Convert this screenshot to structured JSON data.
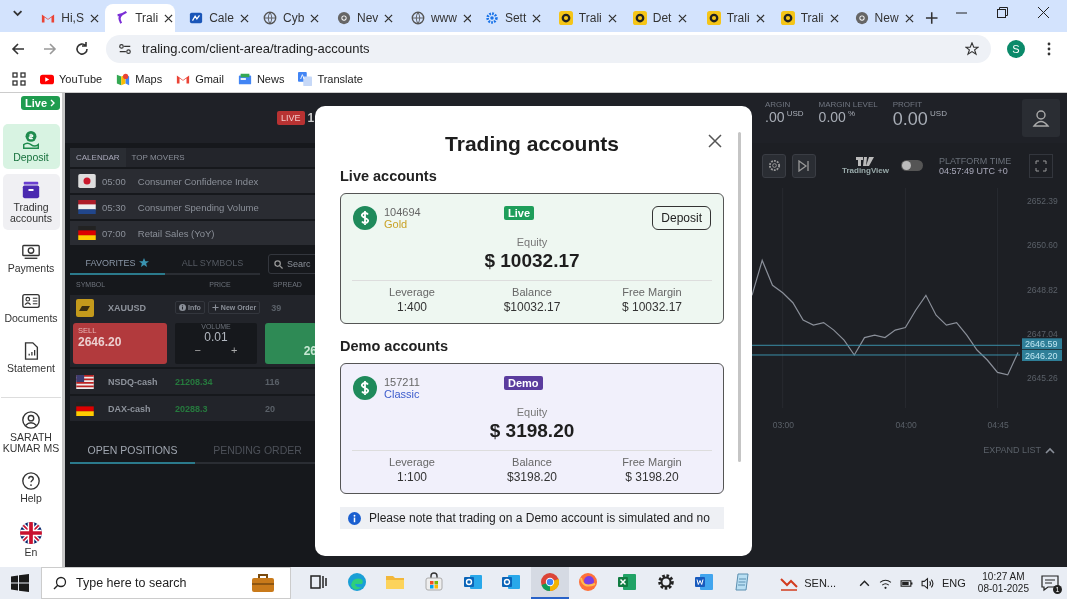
{
  "browser": {
    "tabs": [
      {
        "title": "Hi,S",
        "kind": "gmail",
        "selected": false
      },
      {
        "title": "Trali",
        "kind": "traling",
        "selected": true
      },
      {
        "title": "Cale",
        "kind": "calendar",
        "selected": false
      },
      {
        "title": "Cyb",
        "kind": "globe",
        "selected": false
      },
      {
        "title": "Nev",
        "kind": "chrome",
        "selected": false
      },
      {
        "title": "www",
        "kind": "globe",
        "selected": false
      },
      {
        "title": "Sett",
        "kind": "gear",
        "selected": false
      },
      {
        "title": "Trali",
        "kind": "coin",
        "selected": false
      },
      {
        "title": "Det",
        "kind": "coin",
        "selected": false
      },
      {
        "title": "Trali",
        "kind": "coin",
        "selected": false
      },
      {
        "title": "Trali",
        "kind": "coin",
        "selected": false
      },
      {
        "title": "New",
        "kind": "chrome",
        "selected": false
      }
    ],
    "url": "traling.com/client-area/trading-accounts",
    "profile_initial": "S",
    "bookmarks": [
      {
        "label": "YouTube",
        "kind": "youtube"
      },
      {
        "label": "Maps",
        "kind": "maps"
      },
      {
        "label": "Gmail",
        "kind": "gmail"
      },
      {
        "label": "News",
        "kind": "news"
      },
      {
        "label": "Translate",
        "kind": "translate"
      }
    ]
  },
  "sidebar": {
    "live_badge": "Live",
    "items": [
      {
        "label": "Deposit",
        "kind": "deposit",
        "selected": true,
        "hovered": false
      },
      {
        "label": "Trading accounts",
        "kind": "accounts",
        "selected": false,
        "hovered": true
      },
      {
        "label": "Payments",
        "kind": "payments",
        "selected": false,
        "hovered": false
      },
      {
        "label": "Documents",
        "kind": "documents",
        "selected": false,
        "hovered": false
      },
      {
        "label": "Statement",
        "kind": "statement",
        "selected": false,
        "hovered": false
      }
    ],
    "bottom_items": [
      {
        "label": "SARATH KUMAR MS",
        "kind": "user"
      },
      {
        "label": "Help",
        "kind": "help"
      },
      {
        "label": "En",
        "kind": "flag"
      }
    ]
  },
  "header": {
    "live_tag": "LIVE",
    "live_value": "1",
    "stats": [
      {
        "label": "ARGIN",
        "value": ".00",
        "unit": "USD"
      },
      {
        "label": "MARGIN LEVEL",
        "value": "0.00",
        "unit": "%"
      },
      {
        "label": "PROFIT",
        "value": "0.00",
        "unit": "USD"
      }
    ]
  },
  "market_panel": {
    "news_tabs": [
      {
        "label": "CALENDAR",
        "selected": true
      },
      {
        "label": "TOP MOVERS",
        "selected": false
      }
    ],
    "events": [
      {
        "time": "05:00",
        "title": "Consumer Confidence Index",
        "kind": "japan"
      },
      {
        "time": "05:30",
        "title": "Consumer Spending Volume",
        "kind": "netherlands"
      },
      {
        "time": "07:00",
        "title": "Retail Sales (YoY)",
        "kind": "germany"
      }
    ],
    "symbol_tabs": [
      {
        "label": "FAVORITES",
        "selected": true
      },
      {
        "label": "ALL SYMBOLS",
        "selected": false
      }
    ],
    "search": {
      "placeholder": "Searc"
    },
    "columns": [
      "SYMBOL",
      "PRICE",
      "SPREAD"
    ],
    "expanded_row": {
      "symbol": "XAUUSD",
      "info": "Info",
      "new_order": "New Order",
      "spread": "39",
      "sell_label": "SELL",
      "sell_price": "2646.20",
      "volume_label": "VOLUME",
      "volume": "0.01",
      "minus": "−",
      "plus": "+",
      "buy_price": "26"
    },
    "rows": [
      {
        "symbol": "NSDQ-cash",
        "price": "21208.34",
        "spread": "116",
        "kind": "us"
      },
      {
        "symbol": "DAX-cash",
        "price": "20288.3",
        "spread": "20",
        "kind": "germany"
      }
    ],
    "position_tabs": [
      {
        "label": "OPEN POSITIONS",
        "selected": true
      },
      {
        "label": "PENDING ORDER",
        "selected": false
      }
    ]
  },
  "chart_panel": {
    "brand": "TradingView",
    "toggle_on": false,
    "platform_time_label": "PLATFORM TIME",
    "platform_time": "04:57:49 UTC +0",
    "expand_list": "EXPAND LIST",
    "chart_data": {
      "type": "line",
      "x": [
        165,
        170,
        175,
        180,
        185,
        190,
        195,
        200,
        205,
        210,
        215,
        220,
        225,
        230,
        235,
        240,
        245,
        250,
        255,
        260,
        265,
        270,
        275,
        280,
        285,
        290,
        295
      ],
      "grid": true,
      "series": [
        {
          "color": "#8a8f99",
          "values": [
            2648.6,
            2650.0,
            2649.0,
            2648.7,
            2648.3,
            2647.6,
            2647.4,
            2647.5,
            2647.2,
            2646.8,
            2646.2,
            2646.9,
            2647.0,
            2646.9,
            2647.2,
            2647.3,
            2648.0,
            2648.6,
            2647.8,
            2647.4,
            2647.5,
            2647.0,
            2646.4,
            2646.0,
            2645.5,
            2645.4,
            2646.3
          ]
        }
      ],
      "xlim": [
        165,
        296
      ],
      "ylim": [
        2644.07,
        2652.91
      ],
      "xticks": [
        {
          "value": 180,
          "label": "03:00"
        },
        {
          "value": 240,
          "label": "04:00"
        },
        {
          "value": 285,
          "label": "04:45"
        }
      ],
      "yticks": [
        {
          "value": 2652.39,
          "label": "2652.39"
        },
        {
          "value": 2650.6,
          "label": "2650.60"
        },
        {
          "value": 2648.82,
          "label": "2648.82"
        },
        {
          "value": 2647.04,
          "label": "2647.04"
        },
        {
          "value": 2645.26,
          "label": "2645.26"
        }
      ],
      "ref_lines": [
        {
          "axis": "y",
          "value": 2646.59,
          "label": "2646.59"
        },
        {
          "axis": "y",
          "value": 2646.2,
          "label": "2646.20"
        }
      ]
    }
  },
  "modal": {
    "title": "Trading accounts",
    "sections": [
      {
        "heading": "Live accounts",
        "accounts": [
          {
            "kind": "live",
            "number": "104694",
            "tier": "Gold",
            "badge": "Live",
            "deposit": "Deposit",
            "equity_label": "Equity",
            "equity": "$ 10032.17",
            "stats": [
              {
                "label": "Leverage",
                "value": "1:400"
              },
              {
                "label": "Balance",
                "value": "$10032.17"
              },
              {
                "label": "Free Margin",
                "value": "$ 10032.17"
              }
            ]
          }
        ]
      },
      {
        "heading": "Demo accounts",
        "accounts": [
          {
            "kind": "demo",
            "number": "157211",
            "tier": "Classic",
            "badge": "Demo",
            "equity_label": "Equity",
            "equity": "$ 3198.20",
            "stats": [
              {
                "label": "Leverage",
                "value": "1:100"
              },
              {
                "label": "Balance",
                "value": "$3198.20"
              },
              {
                "label": "Free Margin",
                "value": "$ 3198.20"
              }
            ]
          }
        ]
      }
    ],
    "note": "Please note that trading on a Demo account is simulated and no"
  },
  "taskbar": {
    "search_placeholder": "Type here to search",
    "apps": [
      {
        "kind": "taskview",
        "active": false
      },
      {
        "kind": "edge",
        "active": false
      },
      {
        "kind": "explorer",
        "active": false
      },
      {
        "kind": "store",
        "active": false
      },
      {
        "kind": "outlook",
        "active": false
      },
      {
        "kind": "outlook",
        "active": false
      },
      {
        "kind": "chrome",
        "active": true
      },
      {
        "kind": "firefox",
        "active": false
      },
      {
        "kind": "excel",
        "active": false
      },
      {
        "kind": "settings",
        "active": false
      },
      {
        "kind": "word",
        "active": false
      },
      {
        "kind": "notepad",
        "active": false
      }
    ],
    "tray_app": "SEN...",
    "language": "ENG",
    "time": "10:27 AM",
    "date": "08-01-2025",
    "notifications": "1"
  }
}
